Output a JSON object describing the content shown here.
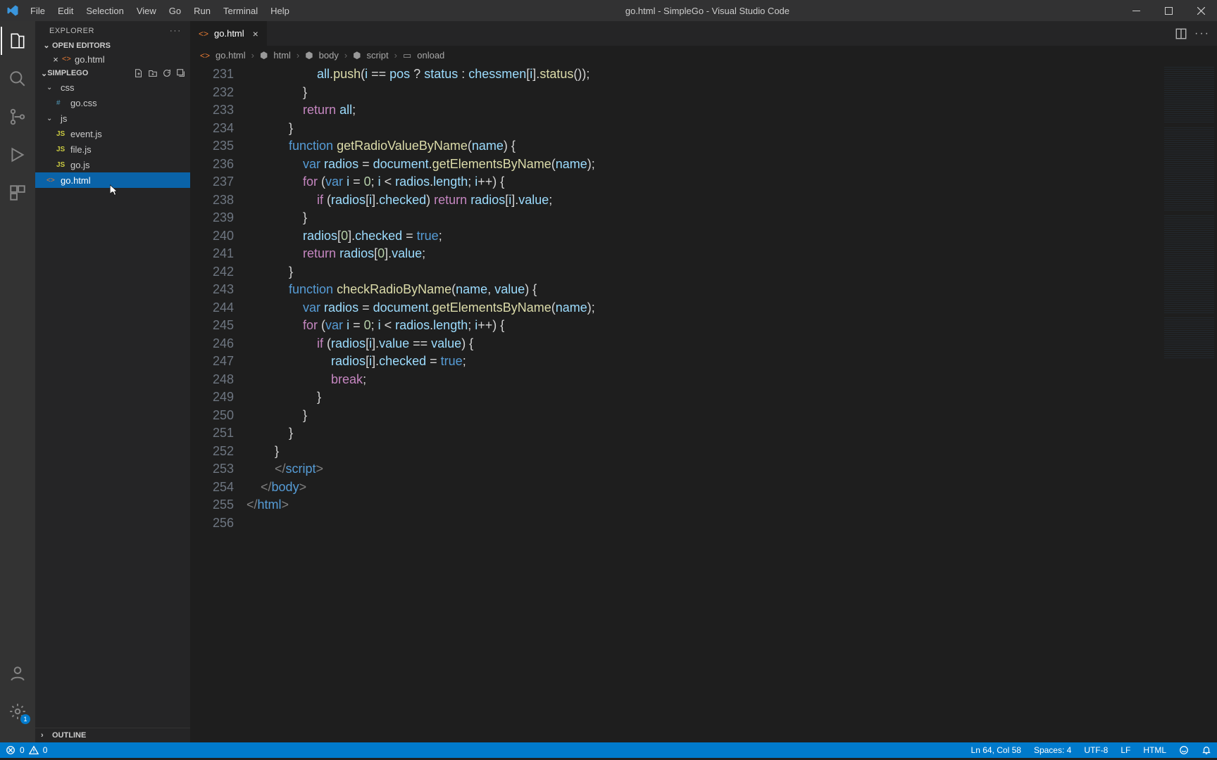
{
  "window": {
    "title": "go.html - SimpleGo - Visual Studio Code",
    "menus": [
      "File",
      "Edit",
      "Selection",
      "View",
      "Go",
      "Run",
      "Terminal",
      "Help"
    ]
  },
  "activity": {
    "badge_settings": "1"
  },
  "sidebar": {
    "title": "EXPLORER",
    "open_editors": "OPEN EDITORS",
    "open_file": "go.html",
    "project": "SIMPLEGO",
    "folders": {
      "css": "css",
      "css_file": "go.css",
      "js": "js",
      "js_files": [
        "event.js",
        "file.js",
        "go.js"
      ],
      "root_file": "go.html"
    },
    "outline": "OUTLINE"
  },
  "tab": {
    "name": "go.html"
  },
  "breadcrumb": {
    "parts": [
      "go.html",
      "html",
      "body",
      "script",
      "onload"
    ]
  },
  "gutter": {
    "start": 231,
    "count": 26
  },
  "code": {
    "lines": [
      {
        "indent": 20,
        "seg": [
          [
            "id",
            "all"
          ],
          [
            "op",
            "."
          ],
          [
            "fn",
            "push"
          ],
          [
            "op",
            "("
          ],
          [
            "id",
            "i"
          ],
          [
            "op",
            " == "
          ],
          [
            "id",
            "pos"
          ],
          [
            "op",
            " ? "
          ],
          [
            "id",
            "status"
          ],
          [
            "op",
            " : "
          ],
          [
            "id",
            "chessmen"
          ],
          [
            "op",
            "["
          ],
          [
            "id",
            "i"
          ],
          [
            "op",
            "]."
          ],
          [
            "fn",
            "status"
          ],
          [
            "op",
            "());"
          ]
        ]
      },
      {
        "indent": 16,
        "seg": [
          [
            "op",
            "}"
          ]
        ]
      },
      {
        "indent": 16,
        "seg": [
          [
            "pink",
            "return"
          ],
          [
            "op",
            " "
          ],
          [
            "id",
            "all"
          ],
          [
            "op",
            ";"
          ]
        ]
      },
      {
        "indent": 12,
        "seg": [
          [
            "op",
            "}"
          ]
        ]
      },
      {
        "indent": 12,
        "seg": [
          [
            "blue",
            "function"
          ],
          [
            "op",
            " "
          ],
          [
            "fn",
            "getRadioValueByName"
          ],
          [
            "op",
            "("
          ],
          [
            "id",
            "name"
          ],
          [
            "op",
            ") {"
          ]
        ]
      },
      {
        "indent": 16,
        "seg": [
          [
            "blue",
            "var"
          ],
          [
            "op",
            " "
          ],
          [
            "id",
            "radios"
          ],
          [
            "op",
            " = "
          ],
          [
            "id",
            "document"
          ],
          [
            "op",
            "."
          ],
          [
            "fn",
            "getElementsByName"
          ],
          [
            "op",
            "("
          ],
          [
            "id",
            "name"
          ],
          [
            "op",
            ");"
          ]
        ]
      },
      {
        "indent": 16,
        "seg": [
          [
            "pink",
            "for"
          ],
          [
            "op",
            " ("
          ],
          [
            "blue",
            "var"
          ],
          [
            "op",
            " "
          ],
          [
            "id",
            "i"
          ],
          [
            "op",
            " = "
          ],
          [
            "num",
            "0"
          ],
          [
            "op",
            "; "
          ],
          [
            "id",
            "i"
          ],
          [
            "op",
            " < "
          ],
          [
            "id",
            "radios"
          ],
          [
            "op",
            "."
          ],
          [
            "id",
            "length"
          ],
          [
            "op",
            "; "
          ],
          [
            "id",
            "i"
          ],
          [
            "op",
            "++) {"
          ]
        ]
      },
      {
        "indent": 20,
        "seg": [
          [
            "pink",
            "if"
          ],
          [
            "op",
            " ("
          ],
          [
            "id",
            "radios"
          ],
          [
            "op",
            "["
          ],
          [
            "id",
            "i"
          ],
          [
            "op",
            "]."
          ],
          [
            "id",
            "checked"
          ],
          [
            "op",
            ") "
          ],
          [
            "pink",
            "return"
          ],
          [
            "op",
            " "
          ],
          [
            "id",
            "radios"
          ],
          [
            "op",
            "["
          ],
          [
            "id",
            "i"
          ],
          [
            "op",
            "]."
          ],
          [
            "id",
            "value"
          ],
          [
            "op",
            ";"
          ]
        ]
      },
      {
        "indent": 16,
        "seg": [
          [
            "op",
            "}"
          ]
        ]
      },
      {
        "indent": 16,
        "seg": [
          [
            "id",
            "radios"
          ],
          [
            "op",
            "["
          ],
          [
            "num",
            "0"
          ],
          [
            "op",
            "]."
          ],
          [
            "id",
            "checked"
          ],
          [
            "op",
            " = "
          ],
          [
            "boolv",
            "true"
          ],
          [
            "op",
            ";"
          ]
        ]
      },
      {
        "indent": 16,
        "seg": [
          [
            "pink",
            "return"
          ],
          [
            "op",
            " "
          ],
          [
            "id",
            "radios"
          ],
          [
            "op",
            "["
          ],
          [
            "num",
            "0"
          ],
          [
            "op",
            "]."
          ],
          [
            "id",
            "value"
          ],
          [
            "op",
            ";"
          ]
        ]
      },
      {
        "indent": 12,
        "seg": [
          [
            "op",
            "}"
          ]
        ]
      },
      {
        "indent": 12,
        "seg": [
          [
            "blue",
            "function"
          ],
          [
            "op",
            " "
          ],
          [
            "fn",
            "checkRadioByName"
          ],
          [
            "op",
            "("
          ],
          [
            "id",
            "name"
          ],
          [
            "op",
            ", "
          ],
          [
            "id",
            "value"
          ],
          [
            "op",
            ") {"
          ]
        ]
      },
      {
        "indent": 16,
        "seg": [
          [
            "blue",
            "var"
          ],
          [
            "op",
            " "
          ],
          [
            "id",
            "radios"
          ],
          [
            "op",
            " = "
          ],
          [
            "id",
            "document"
          ],
          [
            "op",
            "."
          ],
          [
            "fn",
            "getElementsByName"
          ],
          [
            "op",
            "("
          ],
          [
            "id",
            "name"
          ],
          [
            "op",
            ");"
          ]
        ]
      },
      {
        "indent": 16,
        "seg": [
          [
            "pink",
            "for"
          ],
          [
            "op",
            " ("
          ],
          [
            "blue",
            "var"
          ],
          [
            "op",
            " "
          ],
          [
            "id",
            "i"
          ],
          [
            "op",
            " = "
          ],
          [
            "num",
            "0"
          ],
          [
            "op",
            "; "
          ],
          [
            "id",
            "i"
          ],
          [
            "op",
            " < "
          ],
          [
            "id",
            "radios"
          ],
          [
            "op",
            "."
          ],
          [
            "id",
            "length"
          ],
          [
            "op",
            "; "
          ],
          [
            "id",
            "i"
          ],
          [
            "op",
            "++) {"
          ]
        ]
      },
      {
        "indent": 20,
        "seg": [
          [
            "pink",
            "if"
          ],
          [
            "op",
            " ("
          ],
          [
            "id",
            "radios"
          ],
          [
            "op",
            "["
          ],
          [
            "id",
            "i"
          ],
          [
            "op",
            "]."
          ],
          [
            "id",
            "value"
          ],
          [
            "op",
            " == "
          ],
          [
            "id",
            "value"
          ],
          [
            "op",
            ") {"
          ]
        ]
      },
      {
        "indent": 24,
        "seg": [
          [
            "id",
            "radios"
          ],
          [
            "op",
            "["
          ],
          [
            "id",
            "i"
          ],
          [
            "op",
            "]."
          ],
          [
            "id",
            "checked"
          ],
          [
            "op",
            " = "
          ],
          [
            "boolv",
            "true"
          ],
          [
            "op",
            ";"
          ]
        ]
      },
      {
        "indent": 24,
        "seg": [
          [
            "pink",
            "break"
          ],
          [
            "op",
            ";"
          ]
        ]
      },
      {
        "indent": 20,
        "seg": [
          [
            "op",
            "}"
          ]
        ]
      },
      {
        "indent": 16,
        "seg": [
          [
            "op",
            "}"
          ]
        ]
      },
      {
        "indent": 12,
        "seg": [
          [
            "op",
            "}"
          ]
        ]
      },
      {
        "indent": 8,
        "seg": [
          [
            "op",
            "}"
          ]
        ]
      },
      {
        "indent": 8,
        "seg": [
          [
            "grey",
            "</"
          ],
          [
            "tag",
            "script"
          ],
          [
            "grey",
            ">"
          ]
        ]
      },
      {
        "indent": 4,
        "seg": [
          [
            "grey",
            "</"
          ],
          [
            "tag",
            "body"
          ],
          [
            "grey",
            ">"
          ]
        ]
      },
      {
        "indent": 0,
        "seg": [
          [
            "grey",
            "</"
          ],
          [
            "tag",
            "html"
          ],
          [
            "grey",
            ">"
          ]
        ]
      },
      {
        "indent": 0,
        "seg": []
      }
    ]
  },
  "status": {
    "errors": "0",
    "warnings": "0",
    "pos": "Ln 64, Col 58",
    "spaces": "Spaces: 4",
    "enc": "UTF-8",
    "eol": "LF",
    "lang": "HTML"
  }
}
